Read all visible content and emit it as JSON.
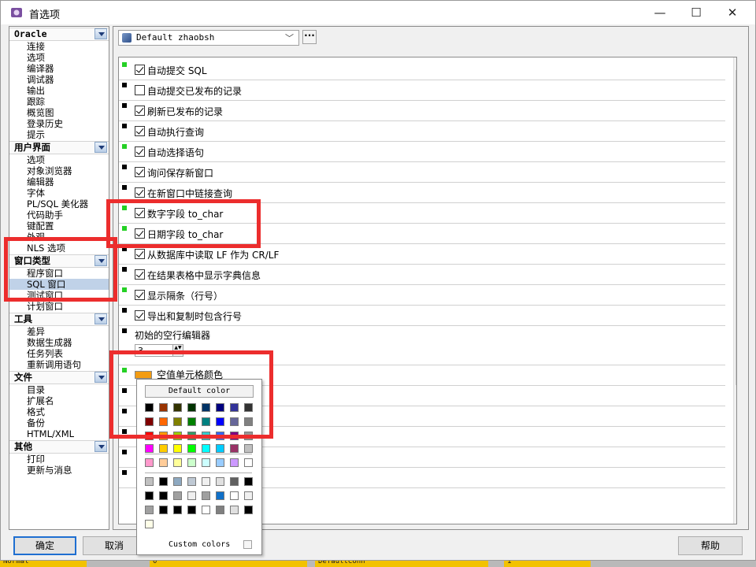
{
  "window": {
    "title": "首选项",
    "minimize": "—",
    "maximize": "☐",
    "close": "✕"
  },
  "sidebar": {
    "categories": [
      {
        "label": "Oracle",
        "items": [
          "连接",
          "选项",
          "编译器",
          "调试器",
          "输出",
          "跟踪",
          "概览图",
          "登录历史",
          "提示"
        ]
      },
      {
        "label": "用户界面",
        "items": [
          "选项",
          "对象浏览器",
          "编辑器",
          "字体",
          "PL/SQL 美化器",
          "代码助手",
          "键配置",
          "外观",
          "NLS 选项"
        ]
      },
      {
        "label": "窗口类型",
        "items": [
          "程序窗口",
          "SQL 窗口",
          "测试窗口",
          "计划窗口"
        ],
        "selected": "SQL 窗口"
      },
      {
        "label": "工具",
        "items": [
          "差异",
          "数据生成器",
          "任务列表",
          "重新调用语句"
        ]
      },
      {
        "label": "文件",
        "items": [
          "目录",
          "扩展名",
          "格式",
          "备份",
          "HTML/XML"
        ]
      },
      {
        "label": "其他",
        "items": [
          "打印",
          "更新与消息"
        ]
      }
    ]
  },
  "profile": {
    "selected": "Default zhaobsh",
    "more_button": "···"
  },
  "options": [
    {
      "label": "自动提交 SQL",
      "checked": true,
      "dot": "green"
    },
    {
      "label": "自动提交已发布的记录",
      "checked": false,
      "dot": "black"
    },
    {
      "label": "刷新已发布的记录",
      "checked": true,
      "dot": "black"
    },
    {
      "label": "自动执行查询",
      "checked": true,
      "dot": "black"
    },
    {
      "label": "自动选择语句",
      "checked": true,
      "dot": "green"
    },
    {
      "label": "询问保存新窗口",
      "checked": true,
      "dot": "black"
    },
    {
      "label": "在新窗口中链接查询",
      "checked": true,
      "dot": "black"
    },
    {
      "label": "数字字段 to_char",
      "checked": true,
      "dot": "green"
    },
    {
      "label": "日期字段 to_char",
      "checked": true,
      "dot": "green"
    },
    {
      "label": "从数据库中读取 LF 作为 CR/LF",
      "checked": true,
      "dot": "black"
    },
    {
      "label": "在结果表格中显示字典信息",
      "checked": true,
      "dot": "black"
    },
    {
      "label": "显示隔条（行号）",
      "checked": true,
      "dot": "green"
    },
    {
      "label": "导出和复制时包含行号",
      "checked": true,
      "dot": "black"
    }
  ],
  "empty_rows_editor": {
    "label": "初始的空行编辑器",
    "value": "3"
  },
  "null_cell_color": {
    "label": "空值单元格颜色",
    "color": "#F39C12"
  },
  "color_popup": {
    "default_label": "Default color",
    "custom_label": "Custom colors",
    "standard_colors": [
      "#000000",
      "#993300",
      "#333300",
      "#003300",
      "#003366",
      "#000080",
      "#333399",
      "#333333",
      "#800000",
      "#FF6600",
      "#808000",
      "#008000",
      "#008080",
      "#0000FF",
      "#666699",
      "#808080",
      "#FF0000",
      "#FF9900",
      "#99CC00",
      "#339966",
      "#33CCCC",
      "#3366FF",
      "#800080",
      "#969696",
      "#FF00FF",
      "#FFCC00",
      "#FFFF00",
      "#00FF00",
      "#00FFFF",
      "#00CCFF",
      "#993366",
      "#C0C0C0",
      "#FF99CC",
      "#FFCC99",
      "#FFFF99",
      "#CCFFCC",
      "#CCFFFF",
      "#99CCFF",
      "#CC99FF",
      "#FFFFFF"
    ],
    "recent_colors": [
      "#C0C0C0",
      "#000000",
      "#8EA9C1",
      "#BFC9D4",
      "#F0F0F0",
      "#E0E0E0",
      "#606060",
      "#000000",
      "#000000",
      "#000000",
      "#A0A0A0",
      "#F0F0F0",
      "#A0A0A0",
      "#1070C8",
      "#FFFFFF",
      "#F0F0F0",
      "#A0A0A0",
      "#000000",
      "#000000",
      "#000000",
      "#FFFFFF",
      "#808080",
      "#E0E0E0",
      "#000000",
      "#FFFFE8"
    ]
  },
  "buttons": {
    "ok": "确定",
    "cancel": "取消",
    "help": "帮助"
  },
  "statusbar": {
    "segments": [
      "Normal",
      "0",
      "DefaultConn",
      "1"
    ]
  }
}
